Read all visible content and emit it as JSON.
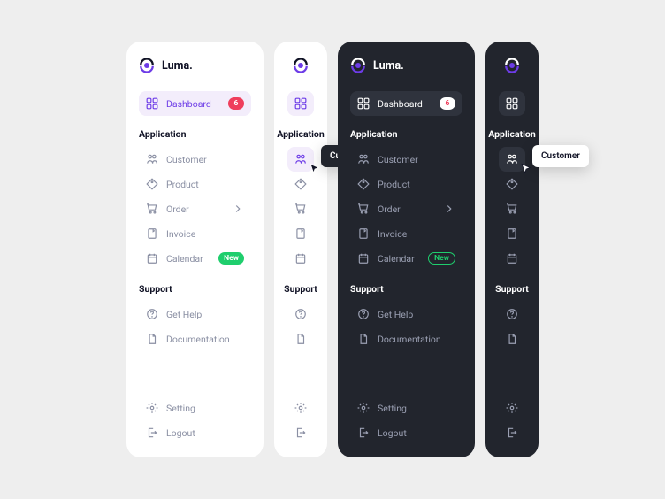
{
  "brand": {
    "name": "Luma."
  },
  "nav": {
    "dashboard": {
      "label": "Dashboard",
      "badge": "6"
    },
    "sections": {
      "application": {
        "label": "Application",
        "items": {
          "customer": {
            "label": "Customer"
          },
          "product": {
            "label": "Product"
          },
          "order": {
            "label": "Order",
            "has_children": true
          },
          "invoice": {
            "label": "Invoice"
          },
          "calendar": {
            "label": "Calendar",
            "badge": "New"
          }
        }
      },
      "support": {
        "label": "Support",
        "items": {
          "help": {
            "label": "Get Help"
          },
          "docs": {
            "label": "Documentation"
          }
        }
      }
    },
    "footer": {
      "setting": {
        "label": "Setting"
      },
      "logout": {
        "label": "Logout"
      }
    }
  },
  "tooltip": {
    "customer": "Customer"
  }
}
